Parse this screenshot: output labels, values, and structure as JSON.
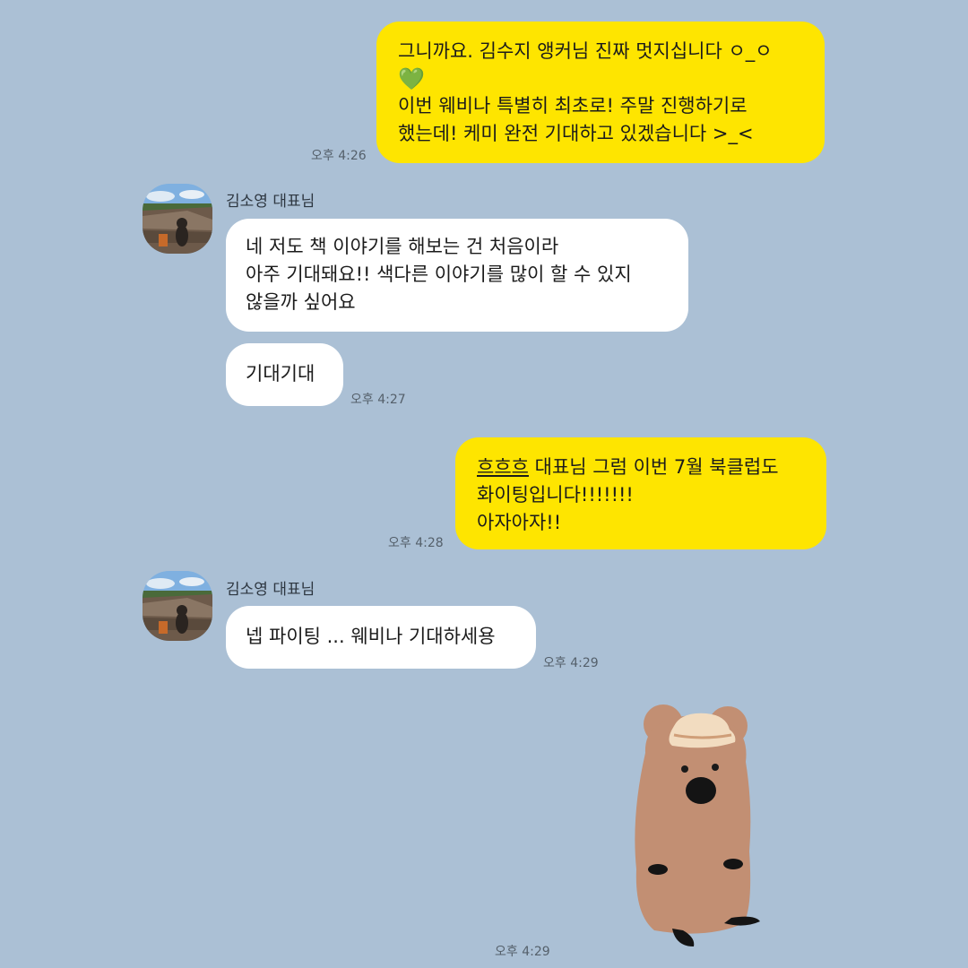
{
  "messages": [
    {
      "id": "m1",
      "side": "me",
      "line1": "그니까요. 김수지 앵커님 진짜 멋지십니다 ㅇ_ㅇ",
      "emoji": "💚",
      "line2": "이번 웨비나 특별히 최초로! 주말 진행하기로",
      "line3": "했는데! 케미 완전 기대하고 있겠습니다 >_<",
      "time": "오후 4:26"
    },
    {
      "id": "m2",
      "side": "them",
      "sender": "김소영 대표님",
      "text": "네 저도 책 이야기를 해보는 건 처음이라\n아주 기대돼요!! 색다른 이야기를 많이 할 수 있지\n않을까 싶어요"
    },
    {
      "id": "m3",
      "side": "them",
      "text": "기대기대",
      "time": "오후 4:27"
    },
    {
      "id": "m4",
      "side": "me",
      "underlined": "흐흐흐",
      "rest_line1": " 대표님 그럼 이번 7월 북클럽도",
      "line2": "화이팅입니다!!!!!!!",
      "line3": "아자아자!!",
      "time": "오후 4:28"
    },
    {
      "id": "m5",
      "side": "them",
      "sender": "김소영 대표님",
      "text": "넵 파이팅 ... 웨비나 기대하세용",
      "time": "오후 4:29"
    },
    {
      "id": "m6",
      "side": "them",
      "sticker": "quokka-with-hat-sticker",
      "time": "오후 4:29"
    }
  ],
  "colors": {
    "background": "#abc0d5",
    "my_bubble": "#fee500",
    "their_bubble": "#ffffff"
  }
}
